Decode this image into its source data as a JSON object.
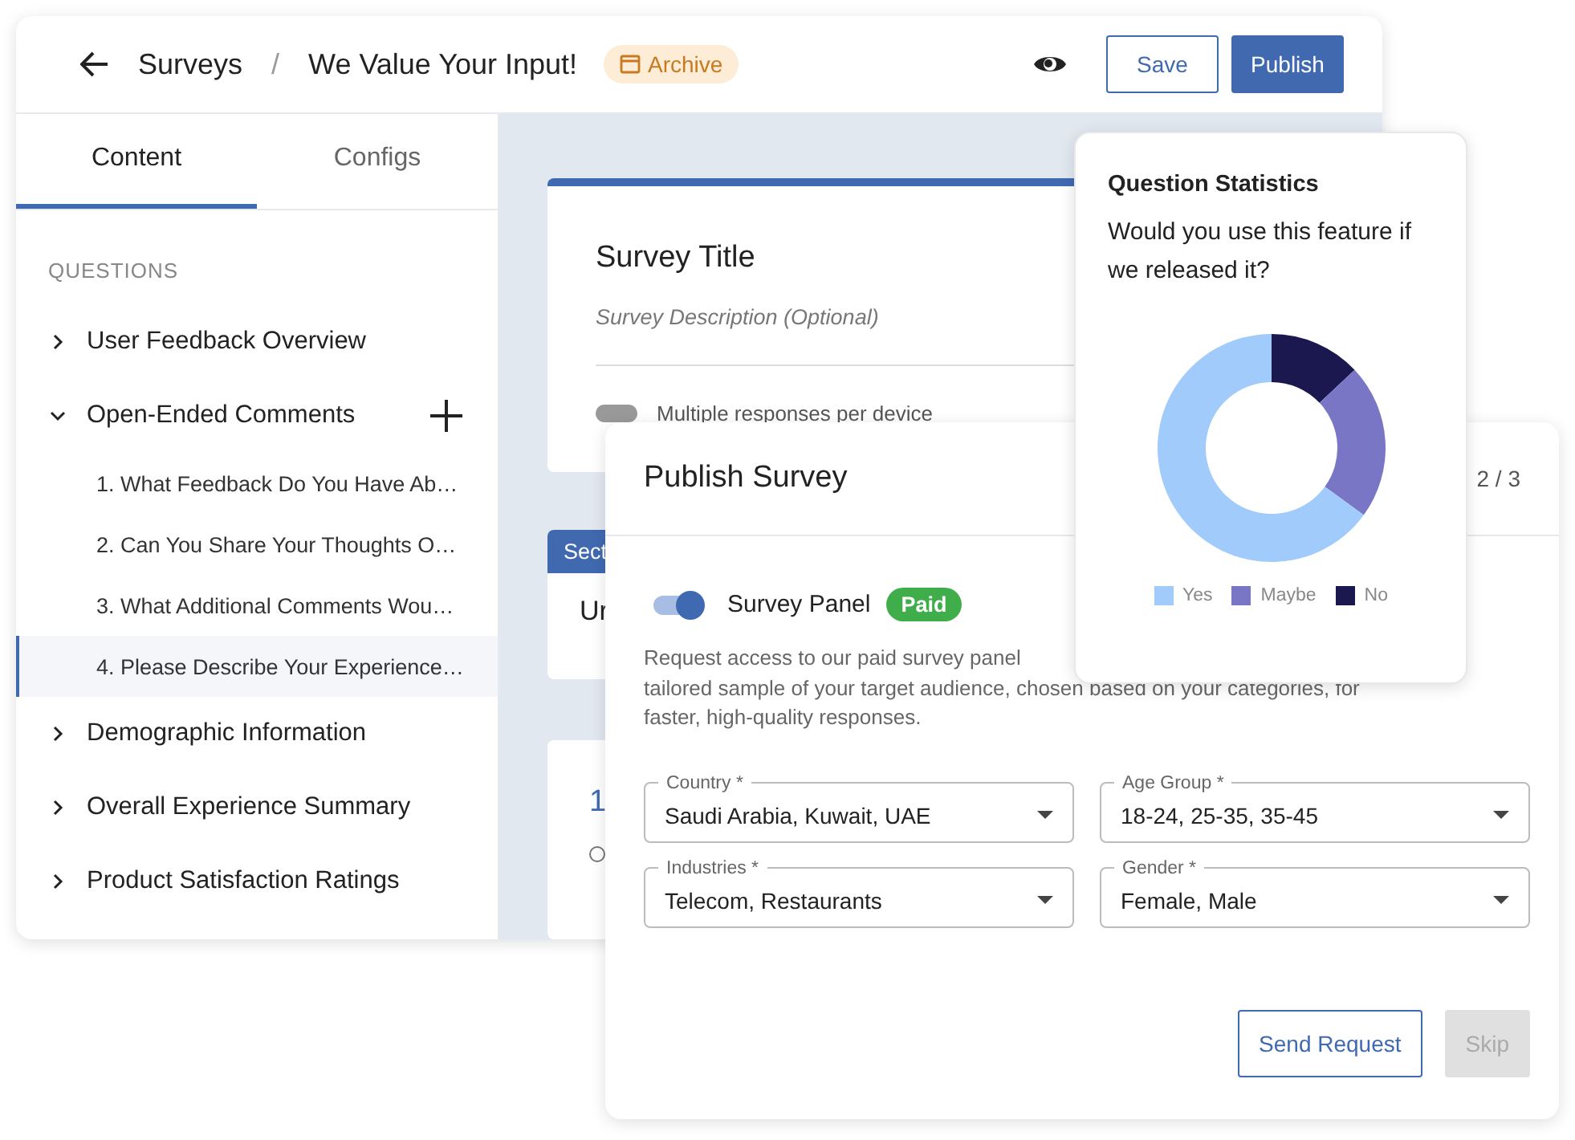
{
  "header": {
    "breadcrumb_root": "Surveys",
    "separator": "/",
    "survey_name": "We Value Your Input!",
    "status_badge": "Archive",
    "buttons": [
      {
        "label": "Save",
        "kind": "outline"
      },
      {
        "label": "Publish",
        "kind": "primary"
      }
    ]
  },
  "sidebar": {
    "tabs": [
      {
        "label": "Content",
        "selected": true
      },
      {
        "label": "Configs",
        "selected": false
      }
    ],
    "section_label": "QUESTIONS",
    "groups": [
      {
        "label": "User Feedback Overview",
        "expanded": false
      },
      {
        "label": "Open-Ended Comments",
        "expanded": true,
        "add_icon": true,
        "children": [
          {
            "label": "1. What Feedback Do You Have Ab…",
            "selected": false
          },
          {
            "label": "2. Can You Share Your Thoughts O…",
            "selected": false
          },
          {
            "label": "3. What Additional Comments Wou…",
            "selected": false
          },
          {
            "label": "4. Please Describe Your Experience…",
            "selected": true
          }
        ]
      },
      {
        "label": "Demographic Information",
        "expanded": false
      },
      {
        "label": "Overall Experience Summary",
        "expanded": false
      },
      {
        "label": "Product Satisfaction Ratings",
        "expanded": false
      }
    ]
  },
  "editor": {
    "survey_title": "Survey Title",
    "description_placeholder": "Survey Description (Optional)",
    "multiple_responses": {
      "label": "Multiple responses per device",
      "on": false
    },
    "section_tab": "Sect",
    "section_title": "Ur",
    "question_number": "1",
    "option_checked": false
  },
  "statistics": {
    "title": "Question Statistics",
    "question": "Would you use this feature if we released it?",
    "legend": [
      {
        "label": "Yes",
        "color": "#a0cbfa"
      },
      {
        "label": "Maybe",
        "color": "#7a76c6"
      },
      {
        "label": "No",
        "color": "#1b1850"
      }
    ]
  },
  "publish_dialog": {
    "title": "Publish Survey",
    "step": "2 / 3",
    "panel": {
      "label": "Survey Panel",
      "on": true,
      "badge": "Paid"
    },
    "description_lines": [
      "Request access to our paid survey panel",
      "tailored sample of your target audience, chosen based on your categories, for",
      "faster, high-quality responses."
    ],
    "fields": [
      {
        "label": "Country *",
        "value": "Saudi Arabia, Kuwait, UAE"
      },
      {
        "label": "Age Group *",
        "value": "18-24, 25-35, 35-45"
      },
      {
        "label": "Industries *",
        "value": "Telecom, Restaurants"
      },
      {
        "label": "Gender *",
        "value": "Female, Male"
      }
    ],
    "buttons": [
      {
        "label": "Send Request",
        "kind": "outline",
        "disabled": false
      },
      {
        "label": "Skip",
        "kind": "filled",
        "disabled": true
      }
    ]
  }
}
